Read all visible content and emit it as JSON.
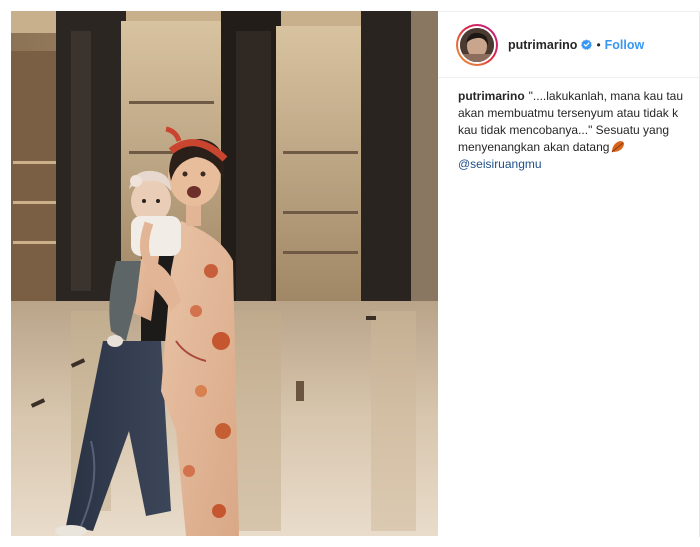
{
  "post": {
    "author": {
      "username": "putrimarino",
      "verified": true,
      "avatar_icon": "profile-avatar",
      "story_ring_colors": [
        "#f09433",
        "#dc2743",
        "#bc1888"
      ]
    },
    "separator": "•",
    "follow_label": "Follow",
    "follow_color": "#3897f0",
    "caption": {
      "username": "putrimarino",
      "lines": [
        "\"....lakukanlah, mana kau tau",
        "akan membuatmu tersenyum atau tidak k",
        "kau tidak mencobanya...\" Sesuatu yang",
        "menyenangkan akan datang"
      ],
      "emoji_icon": "fallen-leaf-emoji",
      "mention": "@seisiruangmu",
      "mention_color": "#1d4e89"
    },
    "photo": {
      "description_icon": "post-photo",
      "alt": "photo"
    }
  }
}
